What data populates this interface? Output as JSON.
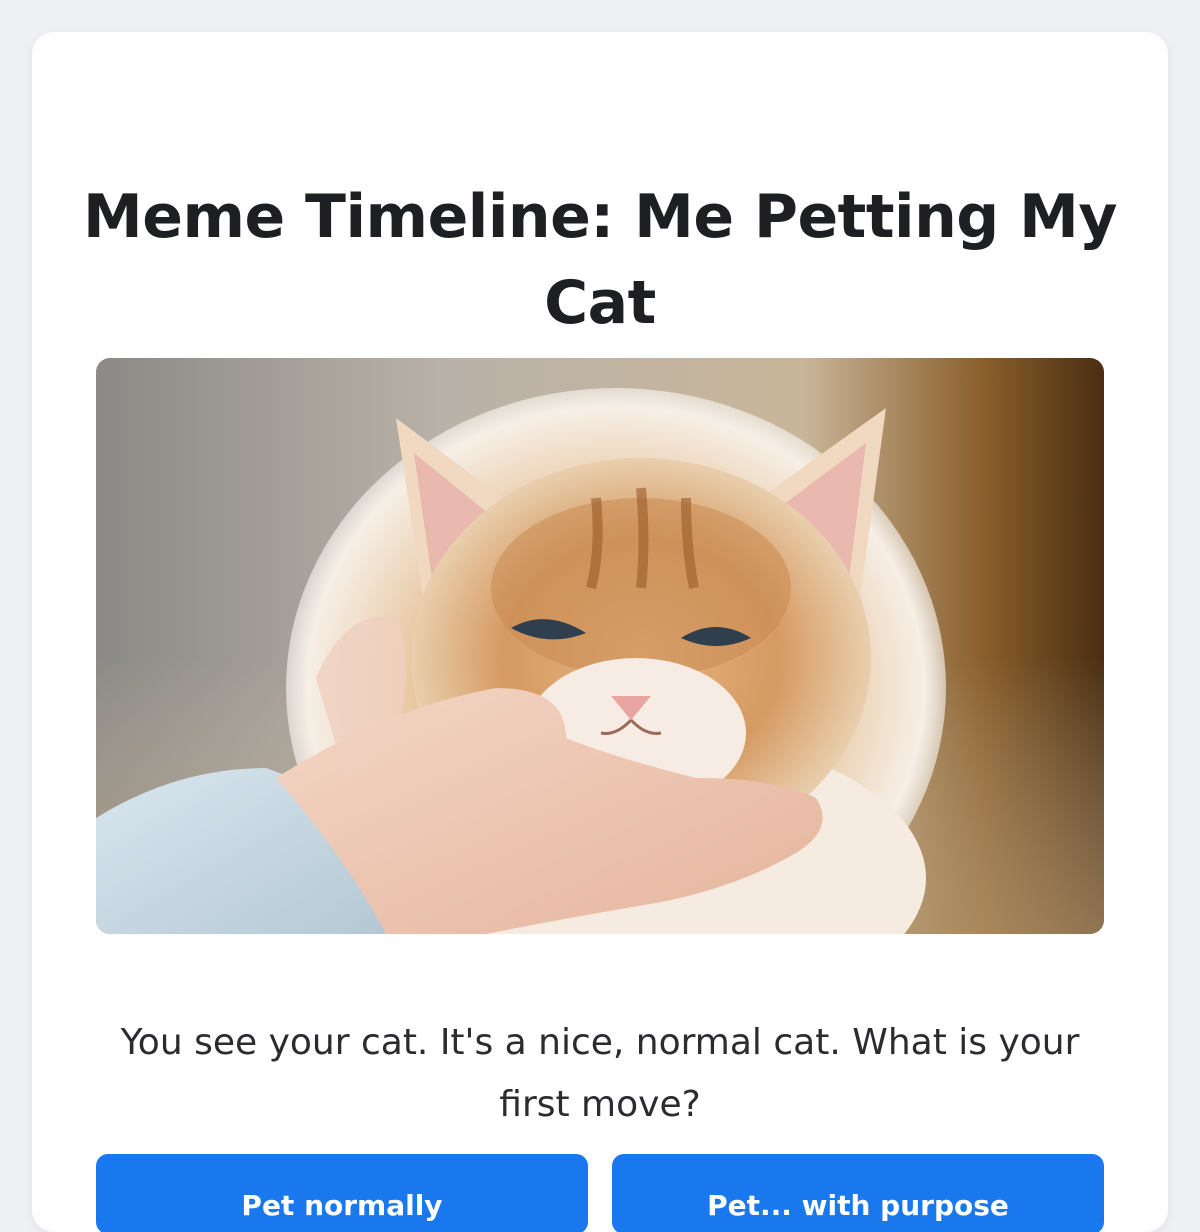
{
  "page": {
    "title": "Meme Timeline: Me Petting My Cat",
    "prompt": "You see your cat. It's a nice, normal cat. What is your first move?"
  },
  "image": {
    "subject": "kitten-photo"
  },
  "choices": [
    {
      "label": "Pet normally"
    },
    {
      "label": "Pet... with purpose"
    }
  ],
  "colors": {
    "background": "#eef0f4",
    "card": "#ffffff",
    "button": "#1a78ee",
    "title_text": "#1e1f22"
  }
}
